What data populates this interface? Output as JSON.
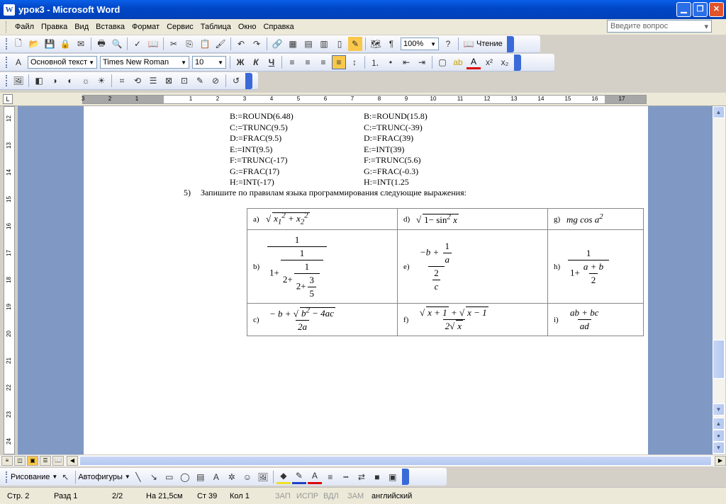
{
  "window": {
    "title": "урок3 - Microsoft Word",
    "app_icon": "W"
  },
  "menu": {
    "items": [
      "Файл",
      "Правка",
      "Вид",
      "Вставка",
      "Формат",
      "Сервис",
      "Таблица",
      "Окно",
      "Справка"
    ],
    "help_placeholder": "Введите вопрос"
  },
  "toolbar_standard": {
    "zoom": "100%",
    "reading_label": "Чтение"
  },
  "toolbar_format": {
    "style": "Основной текст",
    "font": "Times New Roman",
    "size": "10"
  },
  "ruler": {
    "h_labels": [
      "3",
      "2",
      "1",
      "1",
      "2",
      "3",
      "4",
      "5",
      "6",
      "7",
      "8",
      "9",
      "10",
      "11",
      "12",
      "13",
      "14",
      "15",
      "16",
      "17"
    ],
    "v_labels": [
      "12",
      "13",
      "14",
      "15",
      "16",
      "17",
      "18",
      "19",
      "20",
      "21",
      "22",
      "23",
      "24"
    ]
  },
  "document": {
    "left_column": [
      "B:=ROUND(6.48)",
      "C:=TRUNC(9.5)",
      "D:=FRAC(9.5)",
      "E:=INT(9.5)",
      "F:=TRUNC(-17)",
      "G:=FRAC(17)",
      "H:=INT(-17)"
    ],
    "right_column": [
      "B:=ROUND(15.8)",
      "C:=TRUNC(-39)",
      "D:=FRAC(39)",
      "E:=INT(39)",
      "F:=TRUNC(5.6)",
      "G:=FRAC(-0.3)",
      "H:=INT(1.25"
    ],
    "task": {
      "number": "5)",
      "text": "Запишите по правилам языка программирования следующие выражения:"
    },
    "cell_labels": [
      "a)",
      "d)",
      "g)",
      "b)",
      "e)",
      "h)",
      "c)",
      "f)",
      "i)"
    ]
  },
  "drawing": {
    "draw_label": "Рисование",
    "autoshapes_label": "Автофигуры"
  },
  "status": {
    "page": "Стр. 2",
    "section": "Разд 1",
    "pages": "2/2",
    "at": "На 21,5см",
    "line": "Ст 39",
    "col": "Кол 1",
    "rec": "ЗАП",
    "trk": "ИСПР",
    "ext": "ВДЛ",
    "ovr": "ЗАМ",
    "lang": "английский"
  }
}
